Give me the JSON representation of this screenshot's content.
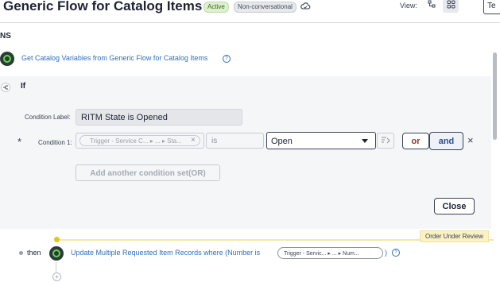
{
  "header": {
    "title": "Generic Flow for Catalog Items",
    "status_badge": "Active",
    "mode_badge": "Non-conversational",
    "view_label": "View:",
    "test_button": "Te"
  },
  "section": {
    "heading": "NS"
  },
  "steps": {
    "get_step": "Get Catalog Variables from Generic Flow for Catalog Items",
    "if_label": "If",
    "then_label": "then",
    "update_step": "Update Multiple Requested Item Records where (Number is",
    "update_pill": "Trigger - Servic... ▸ ... ▸ Num...",
    "update_close": ")",
    "annotation_tag": "Order Under Review"
  },
  "condition_editor": {
    "condition_label_caption": "Condition Label:",
    "condition_label_value": "RITM State is Opened",
    "required_marker": "*",
    "condition_1_caption": "Condition 1:",
    "field_pill": "Trigger - Service C... ▸ ... ▸ Sta...",
    "operator": "is",
    "value_select": "Open",
    "or_button": "or",
    "and_button": "and",
    "remove_icon": "×",
    "add_condition_set_button": "Add another condition set(OR)",
    "close_button": "Close"
  },
  "icons": {
    "cloud": "cloud-icon",
    "view_list": "list-view-icon",
    "view_grid": "grid-view-icon",
    "branch": "branch-icon",
    "data_pill_picker": "data-pill-picker-icon",
    "help": "help-icon",
    "plus": "plus-icon"
  },
  "colors": {
    "accent_link": "#2f6fb8",
    "node_green": "#62d84e",
    "annotation_yellow": "#e7c21d"
  }
}
